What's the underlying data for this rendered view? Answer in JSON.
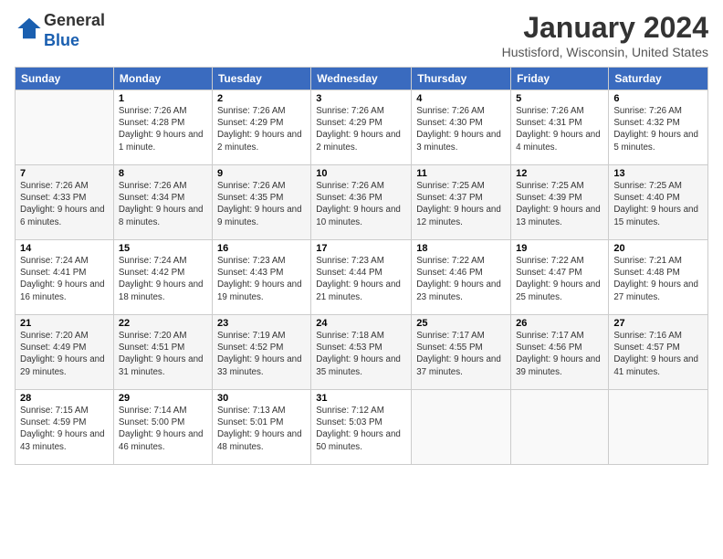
{
  "logo": {
    "general": "General",
    "blue": "Blue"
  },
  "header": {
    "title": "January 2024",
    "location": "Hustisford, Wisconsin, United States"
  },
  "days": [
    "Sunday",
    "Monday",
    "Tuesday",
    "Wednesday",
    "Thursday",
    "Friday",
    "Saturday"
  ],
  "weeks": [
    [
      {
        "day": "",
        "sunrise": "",
        "sunset": "",
        "daylight": ""
      },
      {
        "day": "1",
        "sunrise": "Sunrise: 7:26 AM",
        "sunset": "Sunset: 4:28 PM",
        "daylight": "Daylight: 9 hours and 1 minute."
      },
      {
        "day": "2",
        "sunrise": "Sunrise: 7:26 AM",
        "sunset": "Sunset: 4:29 PM",
        "daylight": "Daylight: 9 hours and 2 minutes."
      },
      {
        "day": "3",
        "sunrise": "Sunrise: 7:26 AM",
        "sunset": "Sunset: 4:29 PM",
        "daylight": "Daylight: 9 hours and 2 minutes."
      },
      {
        "day": "4",
        "sunrise": "Sunrise: 7:26 AM",
        "sunset": "Sunset: 4:30 PM",
        "daylight": "Daylight: 9 hours and 3 minutes."
      },
      {
        "day": "5",
        "sunrise": "Sunrise: 7:26 AM",
        "sunset": "Sunset: 4:31 PM",
        "daylight": "Daylight: 9 hours and 4 minutes."
      },
      {
        "day": "6",
        "sunrise": "Sunrise: 7:26 AM",
        "sunset": "Sunset: 4:32 PM",
        "daylight": "Daylight: 9 hours and 5 minutes."
      }
    ],
    [
      {
        "day": "7",
        "sunrise": "Sunrise: 7:26 AM",
        "sunset": "Sunset: 4:33 PM",
        "daylight": "Daylight: 9 hours and 6 minutes."
      },
      {
        "day": "8",
        "sunrise": "Sunrise: 7:26 AM",
        "sunset": "Sunset: 4:34 PM",
        "daylight": "Daylight: 9 hours and 8 minutes."
      },
      {
        "day": "9",
        "sunrise": "Sunrise: 7:26 AM",
        "sunset": "Sunset: 4:35 PM",
        "daylight": "Daylight: 9 hours and 9 minutes."
      },
      {
        "day": "10",
        "sunrise": "Sunrise: 7:26 AM",
        "sunset": "Sunset: 4:36 PM",
        "daylight": "Daylight: 9 hours and 10 minutes."
      },
      {
        "day": "11",
        "sunrise": "Sunrise: 7:25 AM",
        "sunset": "Sunset: 4:37 PM",
        "daylight": "Daylight: 9 hours and 12 minutes."
      },
      {
        "day": "12",
        "sunrise": "Sunrise: 7:25 AM",
        "sunset": "Sunset: 4:39 PM",
        "daylight": "Daylight: 9 hours and 13 minutes."
      },
      {
        "day": "13",
        "sunrise": "Sunrise: 7:25 AM",
        "sunset": "Sunset: 4:40 PM",
        "daylight": "Daylight: 9 hours and 15 minutes."
      }
    ],
    [
      {
        "day": "14",
        "sunrise": "Sunrise: 7:24 AM",
        "sunset": "Sunset: 4:41 PM",
        "daylight": "Daylight: 9 hours and 16 minutes."
      },
      {
        "day": "15",
        "sunrise": "Sunrise: 7:24 AM",
        "sunset": "Sunset: 4:42 PM",
        "daylight": "Daylight: 9 hours and 18 minutes."
      },
      {
        "day": "16",
        "sunrise": "Sunrise: 7:23 AM",
        "sunset": "Sunset: 4:43 PM",
        "daylight": "Daylight: 9 hours and 19 minutes."
      },
      {
        "day": "17",
        "sunrise": "Sunrise: 7:23 AM",
        "sunset": "Sunset: 4:44 PM",
        "daylight": "Daylight: 9 hours and 21 minutes."
      },
      {
        "day": "18",
        "sunrise": "Sunrise: 7:22 AM",
        "sunset": "Sunset: 4:46 PM",
        "daylight": "Daylight: 9 hours and 23 minutes."
      },
      {
        "day": "19",
        "sunrise": "Sunrise: 7:22 AM",
        "sunset": "Sunset: 4:47 PM",
        "daylight": "Daylight: 9 hours and 25 minutes."
      },
      {
        "day": "20",
        "sunrise": "Sunrise: 7:21 AM",
        "sunset": "Sunset: 4:48 PM",
        "daylight": "Daylight: 9 hours and 27 minutes."
      }
    ],
    [
      {
        "day": "21",
        "sunrise": "Sunrise: 7:20 AM",
        "sunset": "Sunset: 4:49 PM",
        "daylight": "Daylight: 9 hours and 29 minutes."
      },
      {
        "day": "22",
        "sunrise": "Sunrise: 7:20 AM",
        "sunset": "Sunset: 4:51 PM",
        "daylight": "Daylight: 9 hours and 31 minutes."
      },
      {
        "day": "23",
        "sunrise": "Sunrise: 7:19 AM",
        "sunset": "Sunset: 4:52 PM",
        "daylight": "Daylight: 9 hours and 33 minutes."
      },
      {
        "day": "24",
        "sunrise": "Sunrise: 7:18 AM",
        "sunset": "Sunset: 4:53 PM",
        "daylight": "Daylight: 9 hours and 35 minutes."
      },
      {
        "day": "25",
        "sunrise": "Sunrise: 7:17 AM",
        "sunset": "Sunset: 4:55 PM",
        "daylight": "Daylight: 9 hours and 37 minutes."
      },
      {
        "day": "26",
        "sunrise": "Sunrise: 7:17 AM",
        "sunset": "Sunset: 4:56 PM",
        "daylight": "Daylight: 9 hours and 39 minutes."
      },
      {
        "day": "27",
        "sunrise": "Sunrise: 7:16 AM",
        "sunset": "Sunset: 4:57 PM",
        "daylight": "Daylight: 9 hours and 41 minutes."
      }
    ],
    [
      {
        "day": "28",
        "sunrise": "Sunrise: 7:15 AM",
        "sunset": "Sunset: 4:59 PM",
        "daylight": "Daylight: 9 hours and 43 minutes."
      },
      {
        "day": "29",
        "sunrise": "Sunrise: 7:14 AM",
        "sunset": "Sunset: 5:00 PM",
        "daylight": "Daylight: 9 hours and 46 minutes."
      },
      {
        "day": "30",
        "sunrise": "Sunrise: 7:13 AM",
        "sunset": "Sunset: 5:01 PM",
        "daylight": "Daylight: 9 hours and 48 minutes."
      },
      {
        "day": "31",
        "sunrise": "Sunrise: 7:12 AM",
        "sunset": "Sunset: 5:03 PM",
        "daylight": "Daylight: 9 hours and 50 minutes."
      },
      {
        "day": "",
        "sunrise": "",
        "sunset": "",
        "daylight": ""
      },
      {
        "day": "",
        "sunrise": "",
        "sunset": "",
        "daylight": ""
      },
      {
        "day": "",
        "sunrise": "",
        "sunset": "",
        "daylight": ""
      }
    ]
  ]
}
